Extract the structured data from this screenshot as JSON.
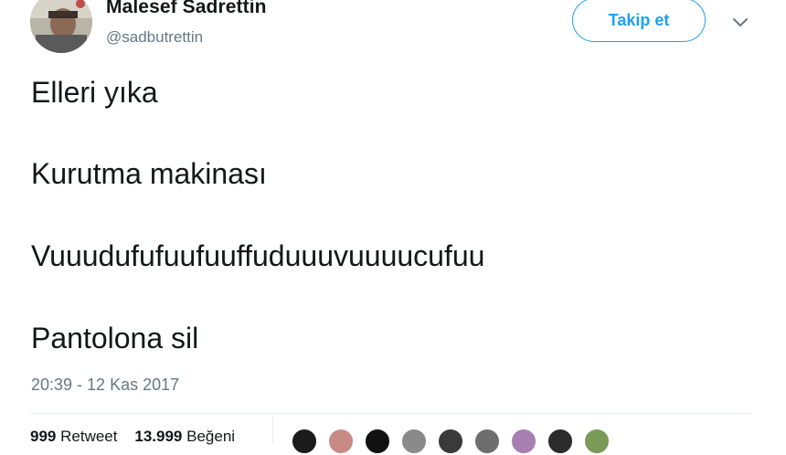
{
  "author": {
    "display_name": "Malesef Sadrettin",
    "handle": "@sadbutrettin",
    "avatar_icon": "profile-photo"
  },
  "follow_button": {
    "label": "Takip et",
    "color": "#1da1f2"
  },
  "more_menu_icon": "chevron-down-icon",
  "tweet": {
    "lines": [
      "Elleri yıka",
      "Kurutma makinası",
      "Vuuudufufuufuuffuduuuvuuuucufuu",
      "Pantolona sil"
    ],
    "timestamp": "20:39 - 12 Kas 2017"
  },
  "stats": {
    "retweets_count": "999",
    "retweets_label": "Retweet",
    "likes_count": "13.999",
    "likes_label": "Beğeni"
  },
  "likers": {
    "colors": [
      "#1b1b1b",
      "#c98a86",
      "#111111",
      "#8a8a8a",
      "#3a3a3a",
      "#6e6e6e",
      "#a77fb0",
      "#2b2b2b",
      "#7a9b57"
    ]
  }
}
